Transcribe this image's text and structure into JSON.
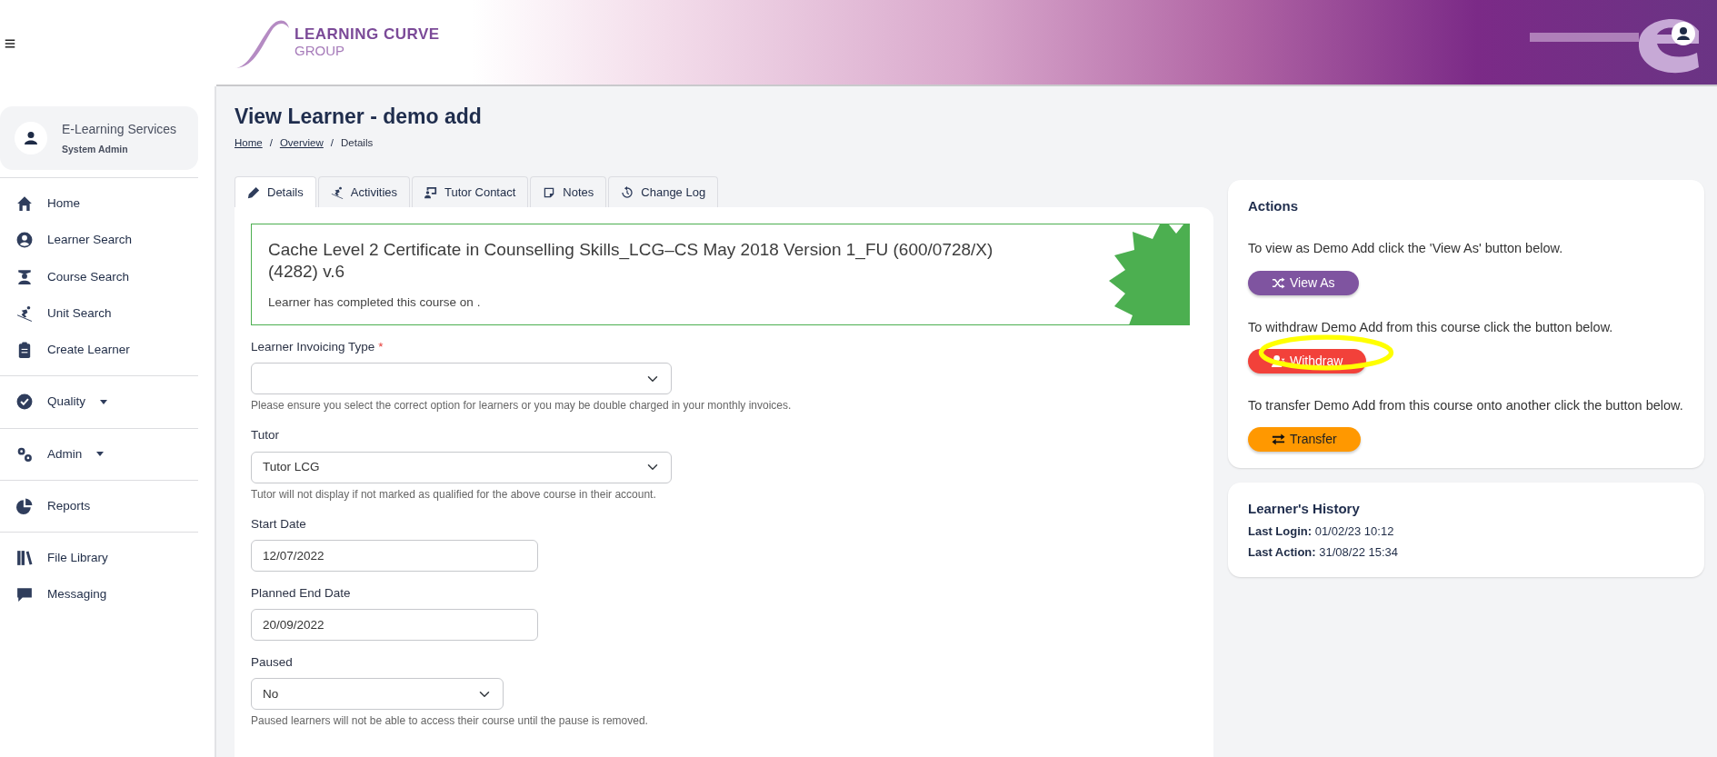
{
  "brand": {
    "name": "LEARNING CURVE",
    "sub": "GROUP"
  },
  "user_card": {
    "name": "E-Learning Services",
    "role": "System Admin"
  },
  "sidebar": {
    "groups": [
      {
        "items": [
          {
            "label": "Home",
            "has_menu": false
          },
          {
            "label": "Learner Search",
            "has_menu": false
          },
          {
            "label": "Course Search",
            "has_menu": false
          },
          {
            "label": "Unit Search",
            "has_menu": false
          },
          {
            "label": "Create Learner",
            "has_menu": false
          }
        ]
      },
      {
        "items": [
          {
            "label": "Quality",
            "has_menu": true
          }
        ]
      },
      {
        "items": [
          {
            "label": "Admin",
            "has_menu": true
          }
        ]
      },
      {
        "items": [
          {
            "label": "Reports",
            "has_menu": false
          }
        ]
      },
      {
        "items": [
          {
            "label": "File Library",
            "has_menu": false
          },
          {
            "label": "Messaging",
            "has_menu": false
          }
        ]
      }
    ]
  },
  "page": {
    "title": "View Learner - demo add",
    "breadcrumb": [
      {
        "label": "Home",
        "link": true
      },
      {
        "separator": "/",
        "label": "Overview",
        "link": true
      },
      {
        "separator": "/",
        "label": "Details",
        "link": false
      }
    ]
  },
  "tabs": [
    {
      "label": "Details",
      "selected": true
    },
    {
      "label": "Activities",
      "selected": false
    },
    {
      "label": "Tutor Contact",
      "selected": false
    },
    {
      "label": "Notes",
      "selected": false
    },
    {
      "label": "Change Log",
      "selected": false
    }
  ],
  "course_panel": {
    "title": "Cache Level 2 Certificate in Counselling Skills_LCG–CS May 2018 Version 1_FU (600/0728/X) (4282) v.6",
    "note": "Learner has completed this course on ."
  },
  "form": {
    "fields": [
      {
        "kind": "select",
        "label": "Learner Invoicing Type",
        "required_mark": "*",
        "help": "Please ensure you select the correct option for learners or you may be double charged in your monthly invoices."
      },
      {
        "kind": "select",
        "label": "Tutor",
        "value": "Tutor LCG",
        "help": "Tutor will not display if not marked as qualified for the above course in their account."
      },
      {
        "kind": "date",
        "label": "Start Date",
        "value": "12/07/2022"
      },
      {
        "kind": "date",
        "label": "Planned End Date",
        "value": "20/09/2022"
      },
      {
        "kind": "short_select",
        "label": "Paused",
        "value": "No",
        "help": "Paused learners will not be able to access their course until the pause is removed."
      }
    ]
  },
  "actions": {
    "title": "Actions",
    "items": [
      {
        "text": "To view as Demo Add click the 'View As' button below.",
        "button": "View As",
        "kind": "view_as",
        "highlighted": false
      },
      {
        "text": "To withdraw Demo Add from this course click the button below.",
        "button": "Withdraw",
        "kind": "withdraw",
        "highlighted": true
      },
      {
        "text": "To transfer Demo Add from this course onto another click the button below.",
        "button": "Transfer",
        "kind": "transfer",
        "highlighted": false
      }
    ]
  },
  "history": {
    "title": "Learner's History",
    "entries": [
      "**Last Login:** 01/02/23 10:12",
      "**Last Action:** 31/08/22 15:34"
    ]
  }
}
